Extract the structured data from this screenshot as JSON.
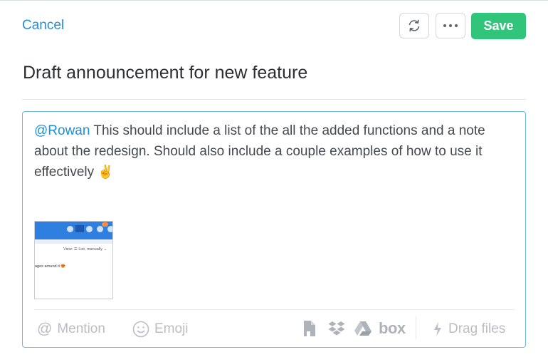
{
  "header": {
    "cancel_label": "Cancel",
    "save_label": "Save",
    "refresh_icon": "refresh-icon",
    "more_icon": "more-dots-icon"
  },
  "task": {
    "title": "Draft announcement for new feature"
  },
  "comment": {
    "mention": "@Rowan",
    "text": " This should include a list of the all the added functions and a note about the redesign. Should also include a couple examples of how to use it effectively ",
    "emoji": "✌️"
  },
  "attachment": {
    "view_text": "View: ☰ List, manually ⌄",
    "text": "ages around it 😍"
  },
  "toolbar": {
    "mention_label": "Mention",
    "emoji_label": "Emoji",
    "box_label": "box",
    "drag_label": "Drag files"
  },
  "colors": {
    "accent": "#1e90d9",
    "save": "#31c47b",
    "editor_border": "#6fb6ec",
    "muted": "#b9bec4"
  }
}
